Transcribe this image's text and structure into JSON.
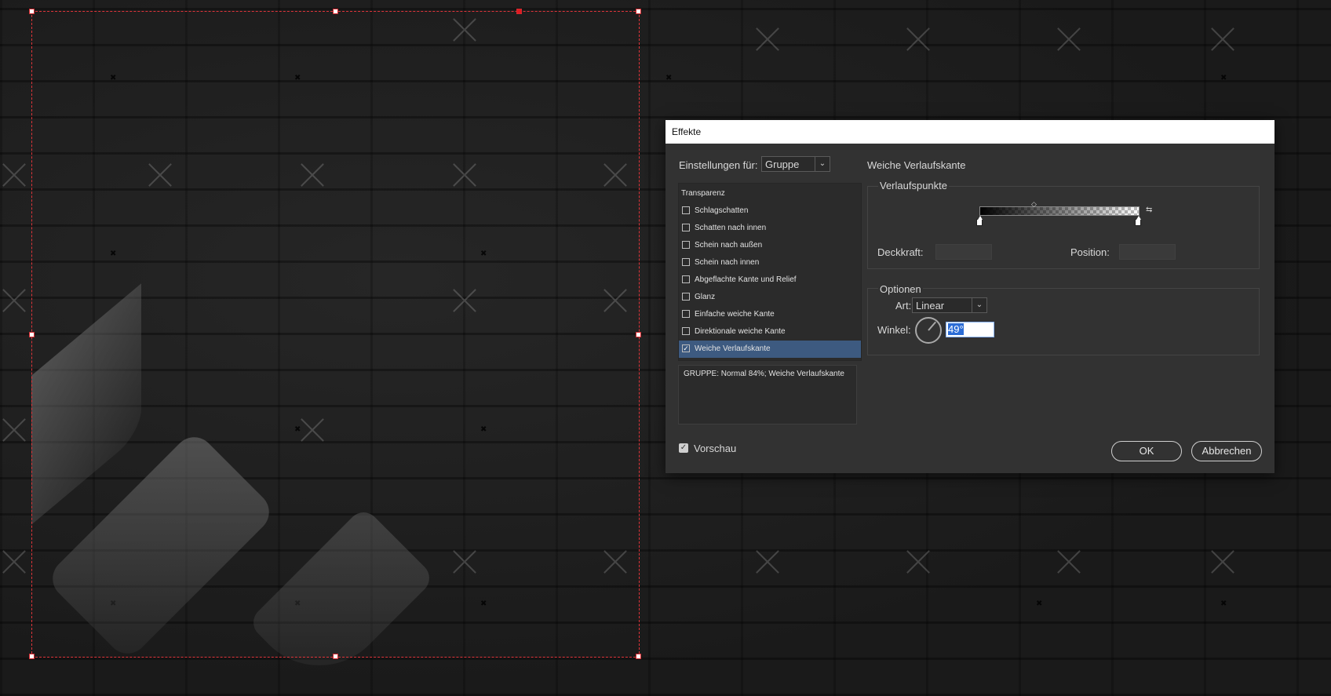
{
  "dialog": {
    "title": "Effekte",
    "settings_label": "Einstellungen für:",
    "settings_value": "Gruppe",
    "list_header": "Transparenz",
    "effects": [
      {
        "label": "Schlagschatten",
        "checked": false
      },
      {
        "label": "Schatten nach innen",
        "checked": false
      },
      {
        "label": "Schein nach außen",
        "checked": false
      },
      {
        "label": "Schein nach innen",
        "checked": false
      },
      {
        "label": "Abgeflachte Kante und Relief",
        "checked": false
      },
      {
        "label": "Glanz",
        "checked": false
      },
      {
        "label": "Einfache weiche Kante",
        "checked": false
      },
      {
        "label": "Direktionale weiche Kante",
        "checked": false
      },
      {
        "label": "Weiche Verlaufskante",
        "checked": true
      }
    ],
    "summary": "GRUPPE: Normal 84%; Weiche Verlaufskante",
    "preview_label": "Vorschau",
    "preview_checked": true,
    "ok_label": "OK",
    "cancel_label": "Abbrechen",
    "panel_title": "Weiche Verlaufskante",
    "stops_group": "Verlaufspunkte",
    "opacity_label": "Deckkraft:",
    "position_label": "Position:",
    "options_group": "Optionen",
    "type_label": "Art:",
    "type_value": "Linear",
    "angle_label": "Winkel:",
    "angle_value": "49°",
    "angle_degrees": 49
  },
  "colors": {
    "frame": "#e0343a",
    "selection": "#3d5a80",
    "dialog_bg": "#323232"
  }
}
